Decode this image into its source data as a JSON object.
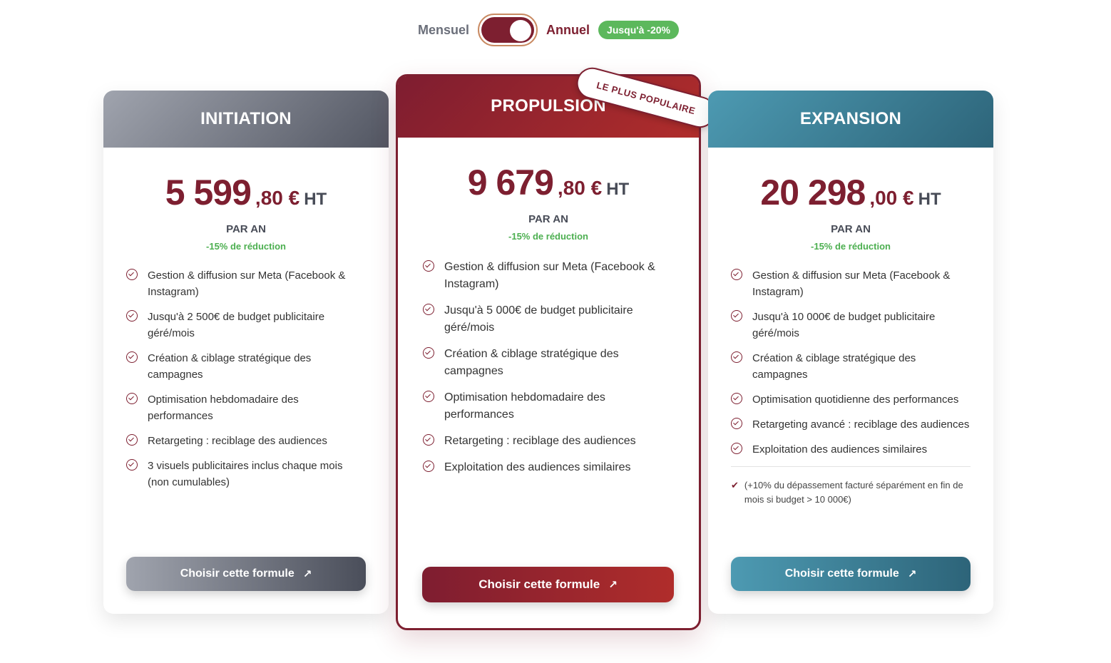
{
  "billing": {
    "monthly_label": "Mensuel",
    "annual_label": "Annuel",
    "discount_badge": "Jusqu'à -20%",
    "selected": "annual"
  },
  "colors": {
    "brand": "#7d1f30",
    "success": "#5cb85c",
    "grey_plan": "#525662",
    "teal_plan": "#2d6479"
  },
  "plans": [
    {
      "name": "INITIATION",
      "price_main": "5 599",
      "price_cents": ",80 €",
      "price_suffix": "HT",
      "period": "PAR AN",
      "reduction": "-15% de réduction",
      "features": [
        "Gestion & diffusion sur Meta (Facebook & Instagram)",
        "Jusqu'à 2 500€ de budget publicitaire géré/mois",
        "Création & ciblage stratégique des campagnes",
        "Optimisation hebdomadaire des performances",
        "Retargeting : reciblage des audiences",
        "3 visuels publicitaires inclus chaque mois (non cumulables)"
      ],
      "cta": "Choisir cette formule",
      "cta_icon": "arrow-up-right-icon"
    },
    {
      "name": "PROPULSION",
      "badge": "LE PLUS POPULAIRE",
      "price_main": "9 679",
      "price_cents": ",80 €",
      "price_suffix": "HT",
      "period": "PAR AN",
      "reduction": "-15% de réduction",
      "features": [
        "Gestion & diffusion sur Meta (Facebook & Instagram)",
        "Jusqu'à 5 000€ de budget publicitaire géré/mois",
        "Création & ciblage stratégique des campagnes",
        "Optimisation hebdomadaire des performances",
        "Retargeting : reciblage des audiences",
        "Exploitation des audiences similaires"
      ],
      "cta": "Choisir cette formule",
      "cta_icon": "arrow-up-right-icon"
    },
    {
      "name": "EXPANSION",
      "price_main": "20 298",
      "price_cents": ",00 €",
      "price_suffix": "HT",
      "period": "PAR AN",
      "reduction": "-15% de réduction",
      "features": [
        "Gestion & diffusion sur Meta (Facebook & Instagram)",
        "Jusqu'à 10 000€ de budget publicitaire géré/mois",
        "Création & ciblage stratégique des campagnes",
        "Optimisation quotidienne des performances",
        "Retargeting avancé : reciblage des audiences",
        "Exploitation des audiences similaires"
      ],
      "note": "(+10% du dépassement facturé séparément en fin de mois si budget > 10 000€)",
      "cta": "Choisir cette formule",
      "cta_icon": "arrow-up-right-icon"
    }
  ]
}
